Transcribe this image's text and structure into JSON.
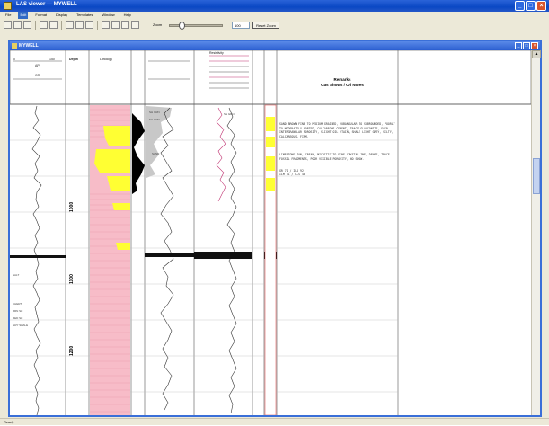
{
  "window": {
    "title": "LAS viewer — MYWELL"
  },
  "menu": {
    "items": [
      "File",
      "Edit",
      "Format",
      "Display",
      "Templates",
      "Window",
      "Help"
    ]
  },
  "toolbar": {
    "zoom_label": "Zoom",
    "zoom_value": "100",
    "reset_zoom_label": "Reset Zoom"
  },
  "document": {
    "title": "MYWELL"
  },
  "log": {
    "header": {
      "scale_left": "0",
      "scale_right": "150",
      "units_label": "API",
      "gamma_label": "GR",
      "depth_label": "Depth",
      "lithology_label": "Lithology",
      "res_label": "Resistivity",
      "remarks_title": "Remarks",
      "remarks_subtitle": "Gas Shows / Oil Notes"
    },
    "depth_marks": [
      "1000",
      "1100",
      "1200"
    ],
    "remarks": [
      "SAND BROWN FINE TO MEDIUM GRAINED, SUBANGULAR TO SUBROUNDED, POORLY TO MODERATELY SORTED, CALCAREOUS CEMENT, TRACE GLAUCONITE, FAIR INTERGRANULAR POROSITY, SLIGHT OIL STAIN, SHALE LIGHT GREY, SILTY, CALCAREOUS, FIRM.",
      "LIMESTONE TAN, CREAM, MICRITIC TO FINE CRYSTALLINE, DENSE, TRACE FOSSIL FRAGMENTS, POOR VISIBLE POROSITY, NO SHOW.",
      "GR 71 / ILD 92",
      "ILM 71 / LLS 48"
    ]
  },
  "status": {
    "text": "Ready"
  },
  "colors": {
    "titlebar": "#0a48c4",
    "lithology_sand": "#ffff33",
    "lithology_shale": "#f7bcc8",
    "fill_black": "#000000"
  }
}
